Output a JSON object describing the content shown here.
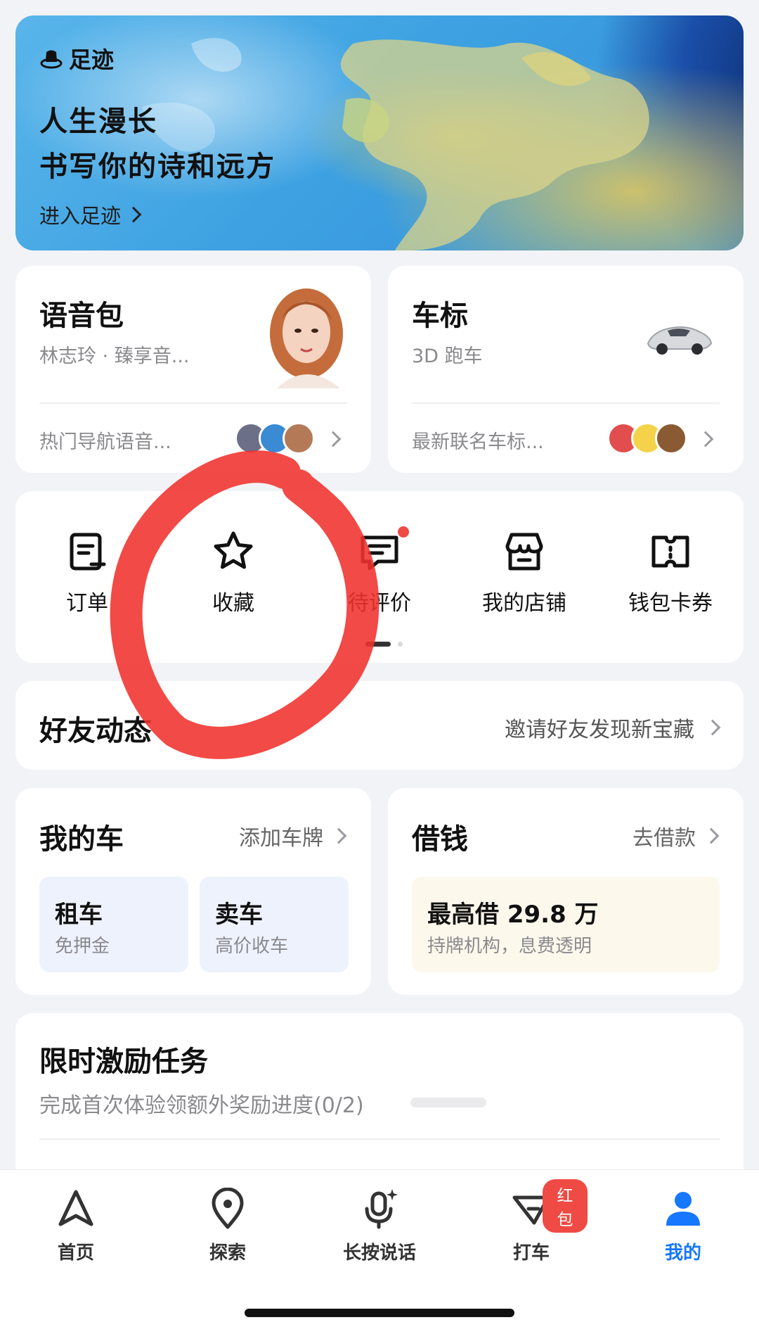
{
  "hero": {
    "brand": "足迹",
    "title_line1": "人生漫长",
    "title_line2": "书写你的诗和远方",
    "link": "进入足迹"
  },
  "voice_pack": {
    "title": "语音包",
    "subtitle": "林志玲 · 臻享音...",
    "footer": "热门导航语音..."
  },
  "car_logo": {
    "title": "车标",
    "subtitle": "3D 跑车",
    "footer": "最新联名车标..."
  },
  "shortcuts": [
    {
      "label": "订单",
      "icon": "order-icon"
    },
    {
      "label": "收藏",
      "icon": "star-icon"
    },
    {
      "label": "待评价",
      "icon": "comment-icon",
      "badge": true
    },
    {
      "label": "我的店铺",
      "icon": "store-icon"
    },
    {
      "label": "钱包卡券",
      "icon": "ticket-icon"
    }
  ],
  "friends": {
    "title": "好友动态",
    "link": "邀请好友发现新宝藏"
  },
  "my_car": {
    "title": "我的车",
    "link": "添加车牌",
    "tiles": [
      {
        "title": "租车",
        "sub": "免押金"
      },
      {
        "title": "卖车",
        "sub": "高价收车"
      }
    ]
  },
  "loan": {
    "title": "借钱",
    "link": "去借款",
    "headline": "最高借 29.8 万",
    "sub": "持牌机构，息费透明"
  },
  "tasks": {
    "title": "限时激励任务",
    "desc": "完成首次体验领额外奖励进度(0/2)",
    "progress": 0
  },
  "tabs": [
    {
      "label": "首页",
      "icon": "navigate-icon"
    },
    {
      "label": "探索",
      "icon": "location-pin-icon"
    },
    {
      "label": "长按说话",
      "icon": "microphone-icon"
    },
    {
      "label": "打车",
      "icon": "taxi-icon",
      "badge": "红包"
    },
    {
      "label": "我的",
      "icon": "user-icon",
      "active": true
    }
  ],
  "colors": {
    "accent": "#1677ff",
    "badge_red": "#f04a44",
    "annotation_red": "#f0312c"
  }
}
